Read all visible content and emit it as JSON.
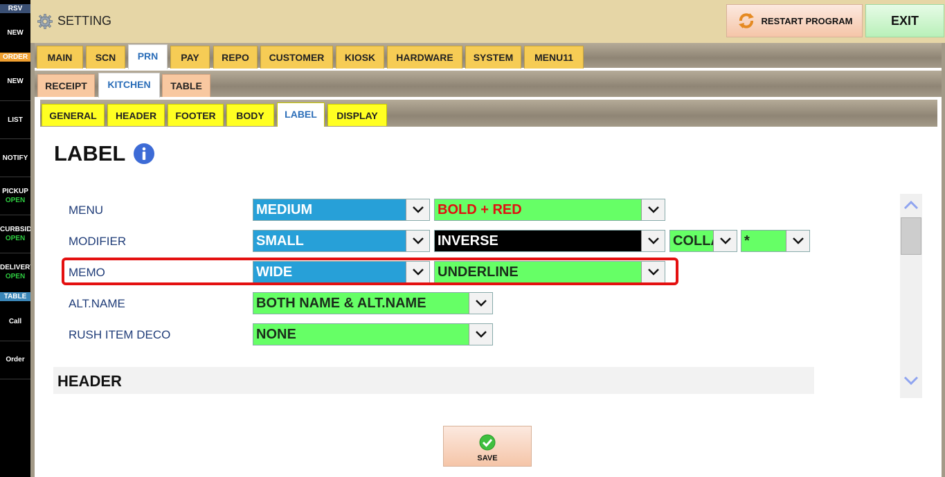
{
  "sidebar": {
    "rsv_label": "RSV",
    "rsv_new": "NEW",
    "order_label": "ORDER",
    "order_new": "NEW",
    "list": "LIST",
    "notify": "NOTIFY",
    "pickup": "PICKUP",
    "pickup_status": "OPEN",
    "curbside": "CURBSID",
    "curbside_status": "OPEN",
    "delivery": "DELIVERY",
    "delivery_status": "OPEN",
    "table_label": "TABLE",
    "call": "Call",
    "order": "Order"
  },
  "header": {
    "title": "SETTING",
    "restart_label": "RESTART PROGRAM",
    "exit_label": "EXIT"
  },
  "main_tabs": [
    "MAIN",
    "SCN",
    "PRN",
    "PAY",
    "REPO",
    "CUSTOMER",
    "KIOSK",
    "HARDWARE",
    "SYSTEM",
    "MENU11"
  ],
  "main_tabs_active": "PRN",
  "sub_tabs": [
    "RECEIPT",
    "KITCHEN",
    "TABLE"
  ],
  "sub_tabs_active": "KITCHEN",
  "section_tabs": [
    "GENERAL",
    "HEADER",
    "FOOTER",
    "BODY",
    "LABEL",
    "DISPLAY"
  ],
  "section_tabs_active": "LABEL",
  "section": {
    "title": "LABEL"
  },
  "rows": {
    "menu": {
      "label": "MENU",
      "size": "MEDIUM",
      "style": "BOLD + RED"
    },
    "modifier": {
      "label": "MODIFIER",
      "size": "SMALL",
      "style": "INVERSE",
      "layout": "COLLAPSE",
      "prefix": "*"
    },
    "memo": {
      "label": "MEMO",
      "size": "WIDE",
      "style": "UNDERLINE"
    },
    "alt_name": {
      "label": "ALT.NAME",
      "value": "BOTH NAME & ALT.NAME"
    },
    "rush": {
      "label": "RUSH ITEM DECO",
      "value": "NONE"
    }
  },
  "header_section": {
    "title": "HEADER"
  },
  "save": {
    "label": "SAVE"
  },
  "colors": {
    "sidebar_bg": "#000000",
    "header_bg": "#e6d6a6",
    "tab_yellow": "#f6cc55",
    "select_blue": "#27a0d8",
    "select_green": "#66ff66",
    "highlight_red": "#e41010",
    "label_blue": "#1f3c78"
  }
}
